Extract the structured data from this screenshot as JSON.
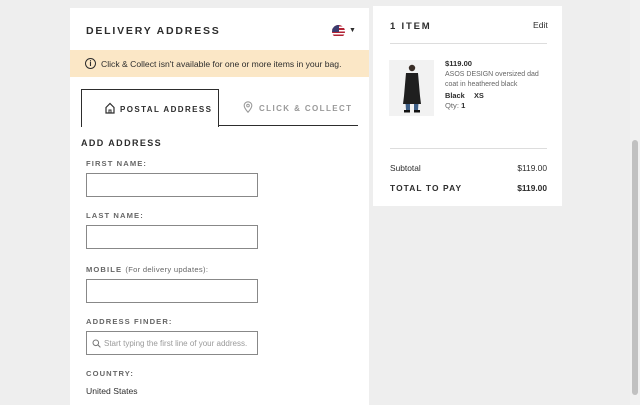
{
  "delivery": {
    "title": "DELIVERY ADDRESS",
    "country_flag_icon": "us-flag-icon",
    "banner_text": "Click & Collect isn't available for one or more items in your bag.",
    "banner_icon": "info-icon",
    "banner_color": "#fbe7c6"
  },
  "tabs": [
    {
      "label": "POSTAL ADDRESS",
      "icon": "home-icon",
      "active": true
    },
    {
      "label": "CLICK & COLLECT",
      "icon": "location-pin-icon",
      "active": false
    }
  ],
  "form": {
    "section_title": "ADD ADDRESS",
    "first_name_label": "FIRST NAME:",
    "first_name_value": "",
    "last_name_label": "LAST NAME:",
    "last_name_value": "",
    "mobile_label": "MOBILE",
    "mobile_hint": "(For delivery updates):",
    "mobile_value": "",
    "finder_label": "ADDRESS FINDER:",
    "finder_placeholder": "Start typing the first line of your address.",
    "country_label": "COUNTRY:",
    "country_value": "United States"
  },
  "bag": {
    "title": "1 ITEM",
    "edit_label": "Edit",
    "item": {
      "price": "$119.00",
      "name": "ASOS DESIGN oversized dad coat in heathered black",
      "color": "Black",
      "size": "XS",
      "qty_label": "Qty:",
      "qty_value": "1"
    },
    "subtotal_label": "Subtotal",
    "subtotal_value": "$119.00",
    "total_label": "TOTAL TO PAY",
    "total_value": "$119.00"
  }
}
